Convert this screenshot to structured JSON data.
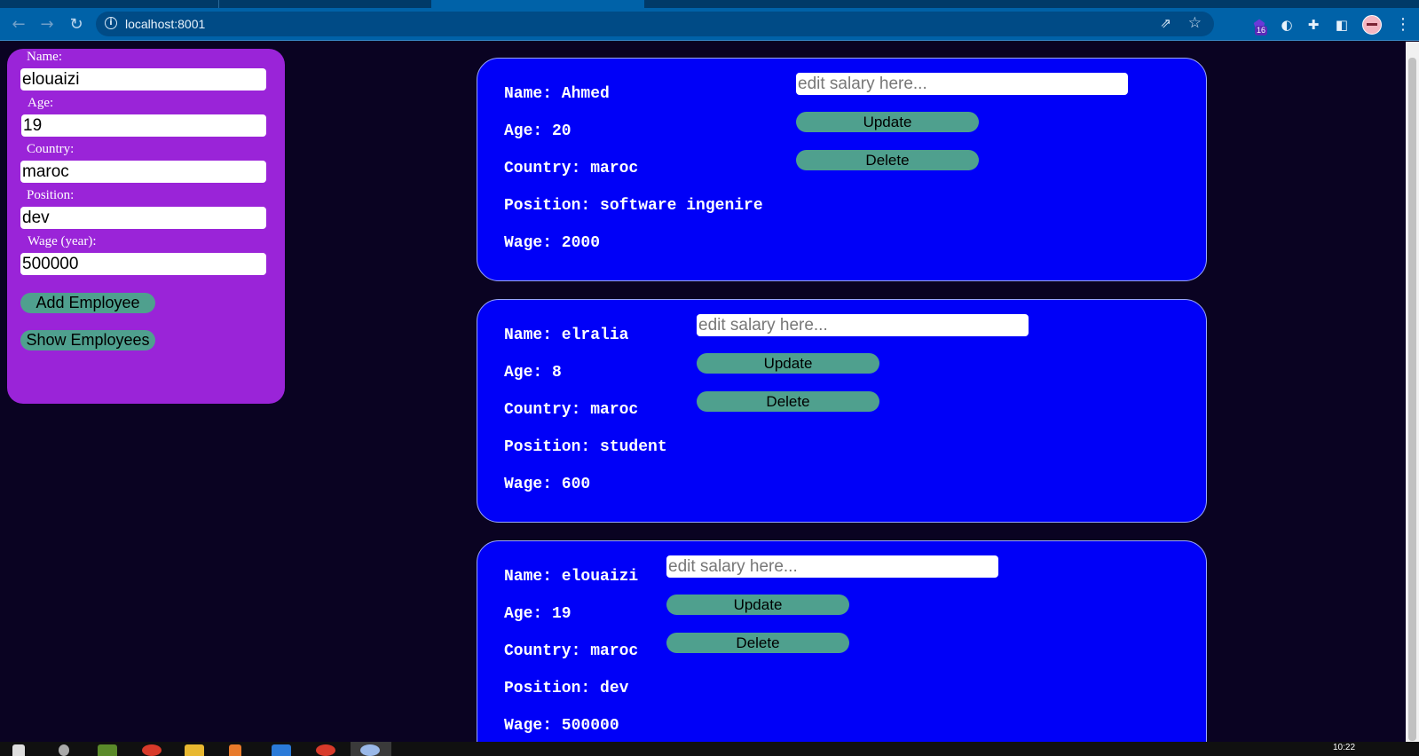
{
  "browser": {
    "url": "localhost:8001",
    "extension_badge": "16"
  },
  "form": {
    "name_label": "Name:",
    "name_value": "elouaizi",
    "age_label": "Age:",
    "age_value": "19",
    "country_label": "Country:",
    "country_value": "maroc",
    "position_label": "Position:",
    "position_value": "dev",
    "wage_label": "Wage (year):",
    "wage_value": "500000",
    "add_button": "Add Employee",
    "show_button": "Show Employees"
  },
  "employees": [
    {
      "name": "Name: Ahmed",
      "age": "Age: 20",
      "country": "Country: maroc",
      "position": "Position: software ingenire",
      "wage": "Wage: 2000",
      "salary_placeholder": "edit salary here...",
      "update_label": "Update",
      "delete_label": "Delete"
    },
    {
      "name": "Name: elralia",
      "age": "Age: 8",
      "country": "Country: maroc",
      "position": "Position: student",
      "wage": "Wage: 600",
      "salary_placeholder": "edit salary here...",
      "update_label": "Update",
      "delete_label": "Delete"
    },
    {
      "name": "Name: elouaizi",
      "age": "Age: 19",
      "country": "Country: maroc",
      "position": "Position: dev",
      "wage": "Wage: 500000",
      "salary_placeholder": "edit salary here...",
      "update_label": "Update",
      "delete_label": "Delete"
    }
  ],
  "taskbar": {
    "clock": "10:22"
  },
  "colors": {
    "page_background": "#0a0322",
    "form_panel": "#9a24d8",
    "card": "#0000f8",
    "button": "#4fa08e"
  },
  "icons": [
    "back-icon",
    "forward-icon",
    "reload-icon",
    "info-icon",
    "share-icon",
    "star-icon",
    "extension-icon",
    "puzzle-icon",
    "side-panel-icon",
    "avatar",
    "menu-icon"
  ]
}
